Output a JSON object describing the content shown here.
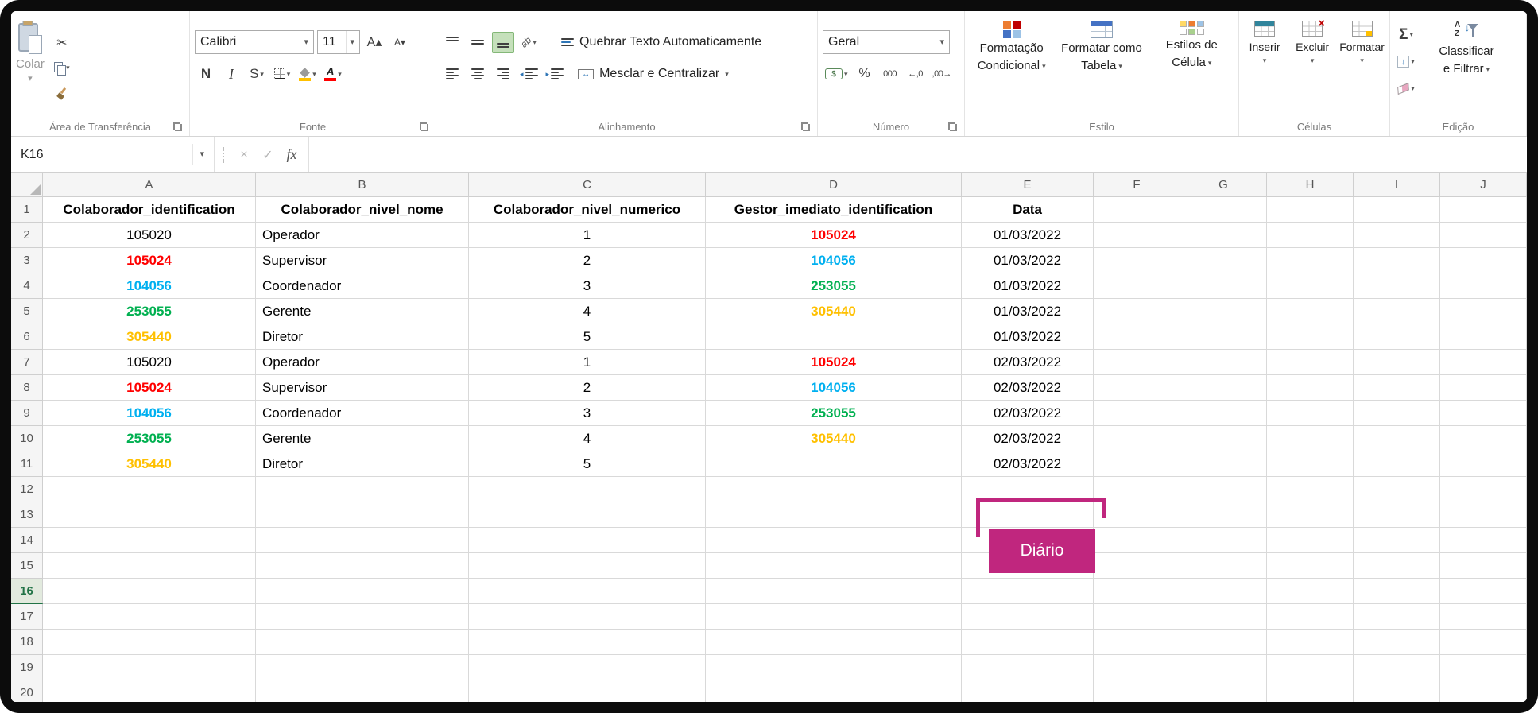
{
  "colors": {
    "black": "#000000",
    "red": "#FF0000",
    "blue": "#00B0F0",
    "green": "#00B050",
    "orange": "#FFC000",
    "accent": "#217346",
    "shape": "#C0267E"
  },
  "icons": {
    "dropdown": "▾",
    "scissors": "✂",
    "cross": "×",
    "check": "✓",
    "sigma": "Σ",
    "arrow_down": "↓",
    "percent": "%",
    "currency": "$",
    "thousands": "000",
    "inc_decimal": "←,0",
    "dec_decimal": ",00→",
    "font_up": "A▴",
    "font_down": "A▾",
    "letter_a": "A",
    "orient": "ab",
    "indent_left": "◂",
    "indent_right": "▸",
    "merge_arrows": "↔",
    "sort_a": "A",
    "sort_z": "Z"
  },
  "ribbon": {
    "clipboard": {
      "label": "Área de Transferência",
      "paste": "Colar"
    },
    "font": {
      "label": "Fonte",
      "family": "Calibri",
      "size": "11",
      "bold": "N",
      "italic": "I",
      "underline": "S"
    },
    "alignment": {
      "label": "Alinhamento",
      "wrap": "Quebrar Texto Automaticamente",
      "merge": "Mesclar e Centralizar"
    },
    "number": {
      "label": "Número",
      "format": "Geral"
    },
    "style": {
      "label": "Estilo",
      "c1": "Formatação",
      "c2": "Condicional",
      "t1": "Formatar como",
      "t2": "Tabela",
      "s1": "Estilos de",
      "s2": "Célula"
    },
    "cells": {
      "label": "Células",
      "insert": "Inserir",
      "delete": "Excluir",
      "format": "Formatar"
    },
    "editing": {
      "label": "Edição",
      "sort1": "Classificar",
      "sort2": "e Filtrar"
    }
  },
  "formula_bar": {
    "name_box": "K16",
    "fx": "fx",
    "formula": ""
  },
  "grid": {
    "columns": [
      "A",
      "B",
      "C",
      "D",
      "E",
      "F",
      "G",
      "H",
      "I",
      "J"
    ],
    "row_count": 20,
    "selected_row": 16,
    "header_row": [
      "Colaborador_identification",
      "Colaborador_nivel_nome",
      "Colaborador_nivel_numerico",
      "Gestor_imediato_identification",
      "Data"
    ],
    "rows": [
      [
        {
          "v": "105020"
        },
        {
          "v": "Operador"
        },
        {
          "v": "1"
        },
        {
          "v": "105024",
          "c": "red"
        },
        {
          "v": "01/03/2022"
        }
      ],
      [
        {
          "v": "105024",
          "c": "red"
        },
        {
          "v": "Supervisor"
        },
        {
          "v": "2"
        },
        {
          "v": "104056",
          "c": "blue"
        },
        {
          "v": "01/03/2022"
        }
      ],
      [
        {
          "v": "104056",
          "c": "blue"
        },
        {
          "v": "Coordenador"
        },
        {
          "v": "3"
        },
        {
          "v": "253055",
          "c": "green"
        },
        {
          "v": "01/03/2022"
        }
      ],
      [
        {
          "v": "253055",
          "c": "green"
        },
        {
          "v": "Gerente"
        },
        {
          "v": "4"
        },
        {
          "v": "305440",
          "c": "orange"
        },
        {
          "v": "01/03/2022"
        }
      ],
      [
        {
          "v": "305440",
          "c": "orange"
        },
        {
          "v": "Diretor"
        },
        {
          "v": "5"
        },
        {
          "v": ""
        },
        {
          "v": "01/03/2022"
        }
      ],
      [
        {
          "v": "105020"
        },
        {
          "v": "Operador"
        },
        {
          "v": "1"
        },
        {
          "v": "105024",
          "c": "red"
        },
        {
          "v": "02/03/2022"
        }
      ],
      [
        {
          "v": "105024",
          "c": "red"
        },
        {
          "v": "Supervisor"
        },
        {
          "v": "2"
        },
        {
          "v": "104056",
          "c": "blue"
        },
        {
          "v": "02/03/2022"
        }
      ],
      [
        {
          "v": "104056",
          "c": "blue"
        },
        {
          "v": "Coordenador"
        },
        {
          "v": "3"
        },
        {
          "v": "253055",
          "c": "green"
        },
        {
          "v": "02/03/2022"
        }
      ],
      [
        {
          "v": "253055",
          "c": "green"
        },
        {
          "v": "Gerente"
        },
        {
          "v": "4"
        },
        {
          "v": "305440",
          "c": "orange"
        },
        {
          "v": "02/03/2022"
        }
      ],
      [
        {
          "v": "305440",
          "c": "orange"
        },
        {
          "v": "Diretor"
        },
        {
          "v": "5"
        },
        {
          "v": ""
        },
        {
          "v": "02/03/2022"
        }
      ]
    ]
  },
  "shape": {
    "label": "Diário"
  }
}
